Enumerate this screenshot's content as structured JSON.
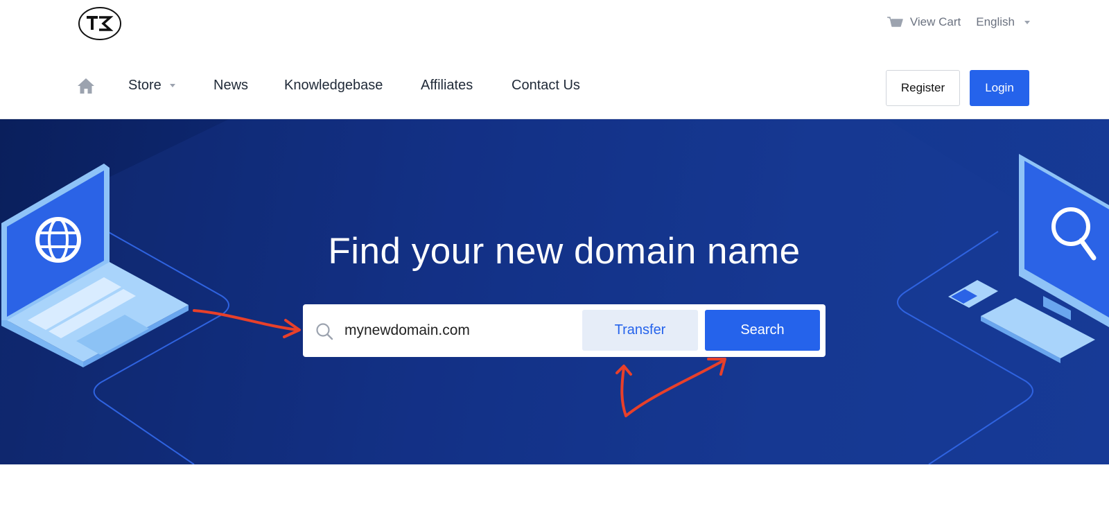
{
  "header": {
    "view_cart_label": "View Cart",
    "language_label": "English",
    "cart_icon": "cart-icon",
    "logo_icon": "tk-logo"
  },
  "nav": {
    "home_icon": "home-icon",
    "items": [
      {
        "label": "Store",
        "dropdown": true
      },
      {
        "label": "News"
      },
      {
        "label": "Knowledgebase"
      },
      {
        "label": "Affiliates"
      },
      {
        "label": "Contact Us"
      }
    ],
    "register_label": "Register",
    "login_label": "Login"
  },
  "hero": {
    "title": "Find your new domain name",
    "search": {
      "value": "mynewdomain.com",
      "icon": "search-icon"
    },
    "transfer_label": "Transfer",
    "search_label": "Search"
  },
  "colors": {
    "primary": "#2563eb",
    "hero_bg": "#102d80",
    "transfer_bg": "#e6edf8",
    "annotation": "#e8402a"
  }
}
